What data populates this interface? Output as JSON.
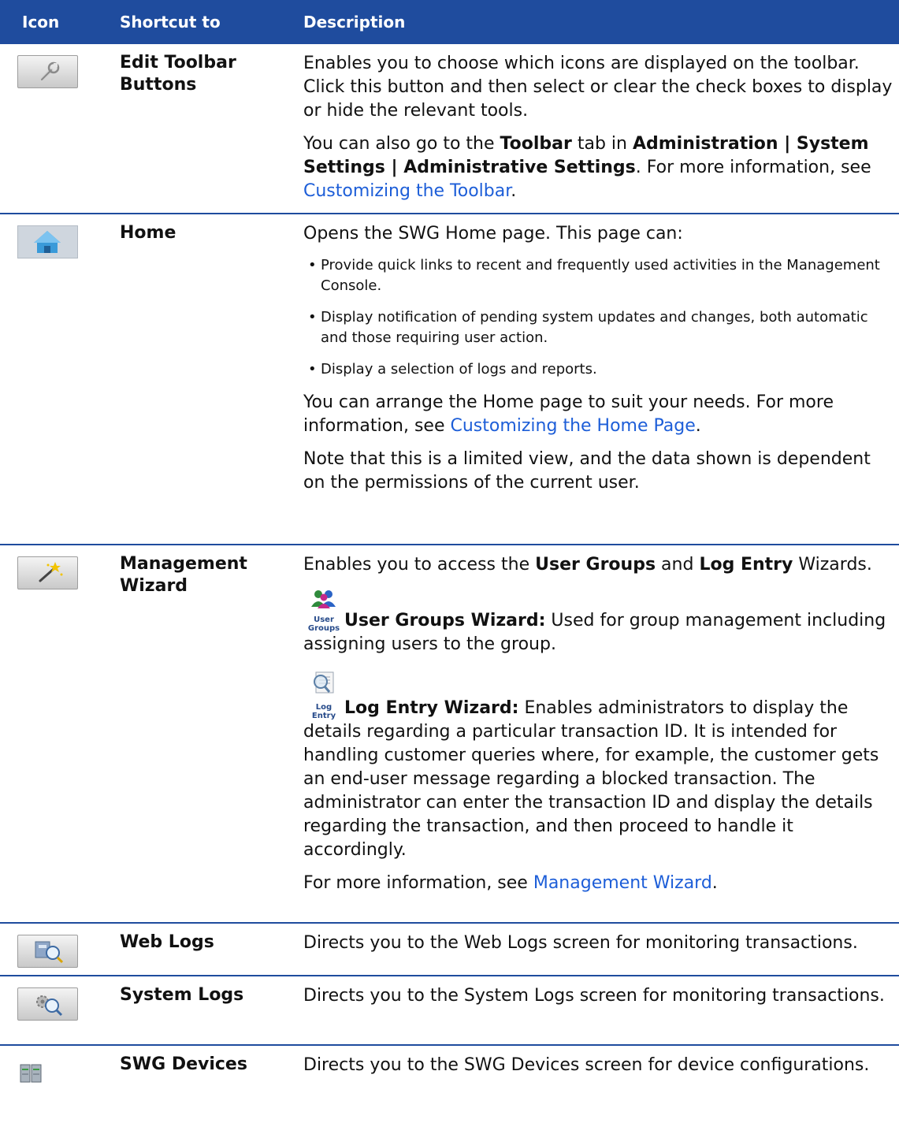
{
  "header": {
    "col_icon": "Icon",
    "col_shortcut": "Shortcut to",
    "col_description": "Description"
  },
  "rows": {
    "edit_toolbar": {
      "icon": "wrench-icon",
      "shortcut": "Edit Toolbar Buttons",
      "desc1": "Enables you to choose which icons are displayed on the toolbar. Click this button and then select or clear the check boxes to display or hide the relevant tools.",
      "desc2_a": "You can also go to the ",
      "desc2_b": "Toolbar",
      "desc2_c": " tab in ",
      "desc2_d": "Administration | System Settings | Administrative Settings",
      "desc2_e": ". For more information, see ",
      "desc2_link": "Customizing the Toolbar",
      "desc2_end": "."
    },
    "home": {
      "icon": "home-icon",
      "shortcut": "Home",
      "desc1": "Opens the SWG Home page. This page can:",
      "bullets": [
        "Provide quick links to recent and frequently used activities in the Management Console.",
        "Display notification of pending system updates and changes, both automatic and those requiring user action.",
        "Display a selection of logs and reports."
      ],
      "desc2_a": "You can arrange the Home page to suit your needs. For more information, see ",
      "desc2_link": "Customizing the Home Page",
      "desc2_end": ".",
      "desc3": "Note that this is a limited view, and the data shown is dependent on the permissions of the current user."
    },
    "mgmt_wizard": {
      "icon": "magic-wand-icon",
      "shortcut": "Management Wizard",
      "desc1_a": "Enables you to access the ",
      "desc1_b": "User Groups",
      "desc1_c": " and ",
      "desc1_d": "Log Entry",
      "desc1_e": " Wizards.",
      "ug_icon": "user-groups-icon",
      "ug_caption": "User Groups",
      "ug_bold": "User Groups Wizard:",
      "ug_text": " Used for group management including assigning users to the group.",
      "le_icon": "log-entry-icon",
      "le_caption": "Log Entry",
      "le_bold": "Log Entry Wizard:",
      "le_text": " Enables administrators to display the details regarding a particular transaction ID. It is intended for handling customer queries where, for example, the customer gets an end-user message regarding a blocked transaction. The administrator can enter the transaction ID and display the details regarding the transaction, and then proceed to handle it accordingly.",
      "more_a": "For more information, see ",
      "more_link": "Management Wizard",
      "more_end": "."
    },
    "web_logs": {
      "icon": "web-logs-icon",
      "shortcut": "Web Logs",
      "desc": "Directs you to the Web Logs screen for monitoring transactions."
    },
    "system_logs": {
      "icon": "system-logs-icon",
      "shortcut": "System Logs",
      "desc": "Directs you to the System Logs screen for monitoring transactions."
    },
    "swg_devices": {
      "icon": "swg-devices-icon",
      "shortcut": "SWG Devices",
      "desc": "Directs you to the SWG Devices screen for device configurations."
    }
  },
  "colors": {
    "header_bg": "#1f4c9e",
    "link": "#1d5ed8"
  }
}
